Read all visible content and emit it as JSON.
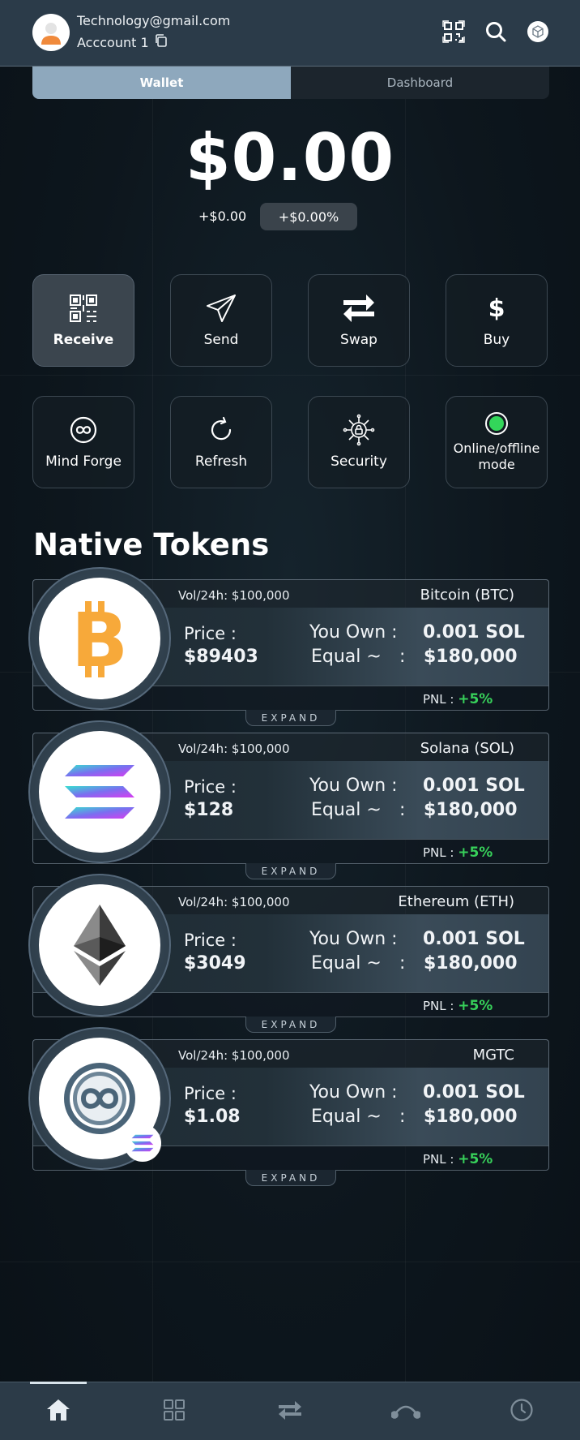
{
  "header": {
    "email": "Technology@gmail.com",
    "account": "Acccount 1"
  },
  "tabs": [
    {
      "label": "Wallet",
      "active": true
    },
    {
      "label": "Dashboard",
      "active": false
    }
  ],
  "balance": {
    "total": "$0.00",
    "change_value": "+$0.00",
    "change_percent": "+$0.00%"
  },
  "actions": [
    {
      "label": "Receive",
      "icon": "qr-code-icon"
    },
    {
      "label": "Send",
      "icon": "paper-plane-icon"
    },
    {
      "label": "Swap",
      "icon": "swap-arrows-icon"
    },
    {
      "label": "Buy",
      "icon": "dollar-icon"
    },
    {
      "label": "Mind Forge",
      "icon": "infinity-icon"
    },
    {
      "label": "Refresh",
      "icon": "refresh-icon"
    },
    {
      "label": "Security",
      "icon": "security-lock-icon"
    },
    {
      "label": "Online/offline mode",
      "icon": "status-dot-icon"
    }
  ],
  "section_title": "Native Tokens",
  "tokens": [
    {
      "name": "Bitcoin (BTC)",
      "vol": "Vol/24h: $100,000",
      "price_label": "Price :",
      "price": "$89403",
      "own_label": "You Own :",
      "own": "0.001 SOL",
      "equal_label": "Equal ~",
      "equal_colon": ":",
      "equal": "$180,000",
      "pnl_label": "PNL :",
      "pnl": "+5%",
      "expand": "EXPAND",
      "icon": "bitcoin-icon"
    },
    {
      "name": "Solana (SOL)",
      "vol": "Vol/24h: $100,000",
      "price_label": "Price :",
      "price": "$128",
      "own_label": "You Own :",
      "own": "0.001 SOL",
      "equal_label": "Equal ~",
      "equal_colon": ":",
      "equal": "$180,000",
      "pnl_label": "PNL :",
      "pnl": "+5%",
      "expand": "EXPAND",
      "icon": "solana-icon"
    },
    {
      "name": "Ethereum (ETH)",
      "vol": "Vol/24h: $100,000",
      "price_label": "Price :",
      "price": "$3049",
      "own_label": "You Own :",
      "own": "0.001 SOL",
      "equal_label": "Equal ~",
      "equal_colon": ":",
      "equal": "$180,000",
      "pnl_label": "PNL :",
      "pnl": "+5%",
      "expand": "EXPAND",
      "icon": "ethereum-icon"
    },
    {
      "name": "MGTC",
      "vol": "Vol/24h: $100,000",
      "price_label": "Price :",
      "price": "$1.08",
      "own_label": "You Own :",
      "own": "0.001 SOL",
      "equal_label": "Equal ~",
      "equal_colon": ":",
      "equal": "$180,000",
      "pnl_label": "PNL :",
      "pnl": "+5%",
      "expand": "EXPAND",
      "icon": "mgtc-icon"
    }
  ],
  "bottom_nav": [
    {
      "icon": "home-icon",
      "active": true
    },
    {
      "icon": "apps-grid-icon",
      "active": false
    },
    {
      "icon": "transfer-arrows-icon",
      "active": false
    },
    {
      "icon": "bridge-icon",
      "active": false
    },
    {
      "icon": "history-clock-icon",
      "active": false
    }
  ],
  "colors": {
    "accent": "#8ea8bd",
    "positive": "#37d05a",
    "header_bg": "#2b3b49",
    "background": "#0d161d"
  }
}
